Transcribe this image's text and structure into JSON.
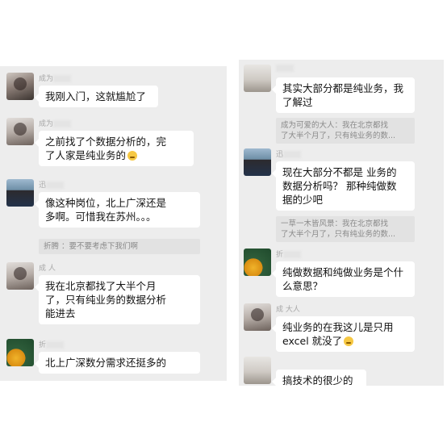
{
  "left": {
    "messages": [
      {
        "sender": "成为",
        "text": "我刚入门，这就尴尬了"
      },
      {
        "sender": "成为",
        "text_1": "之前找了个数据分析的，完",
        "text_2": "了人家是纯业务的"
      },
      {
        "sender": "迅",
        "text_1": "像这种岗位，北上广深还是",
        "text_2": "多啊。可惜我在苏州。。。",
        "quote": "折腾        ：要不要考虑下我们啊"
      },
      {
        "sender": "成            人",
        "text_1": "我在北京都找了大半个月",
        "text_2": "了，只有纯业务的数据分析",
        "text_3": "能进去"
      },
      {
        "sender": "折",
        "text": "北上广深数分需求还挺多的"
      }
    ]
  },
  "right": {
    "messages": [
      {
        "sender": "",
        "text_1": "其实大部分都是纯业务，我",
        "text_2": "了解过",
        "quote_1": "成为可爱的大人：我在北京都找",
        "quote_2": "了大半个月了，只有纯业务的数..."
      },
      {
        "sender": "迅",
        "text_1": "现在大部分不都是  业务的",
        "text_2": "数据分析吗？ 那种纯做数",
        "text_3": "据的少吧",
        "quote_1": "一草一木皆风景：我在北京都找",
        "quote_2": "了大半个月了，只有纯业务的数..."
      },
      {
        "sender": "折",
        "text_1": "纯做数据和纯做业务是个什",
        "text_2": "么意思？"
      },
      {
        "sender": "成            大人",
        "text_1": "纯业务的在我这儿是只用",
        "text_2": "excel 就没了"
      },
      {
        "sender": "",
        "text": "搞技术的很少的"
      }
    ]
  }
}
